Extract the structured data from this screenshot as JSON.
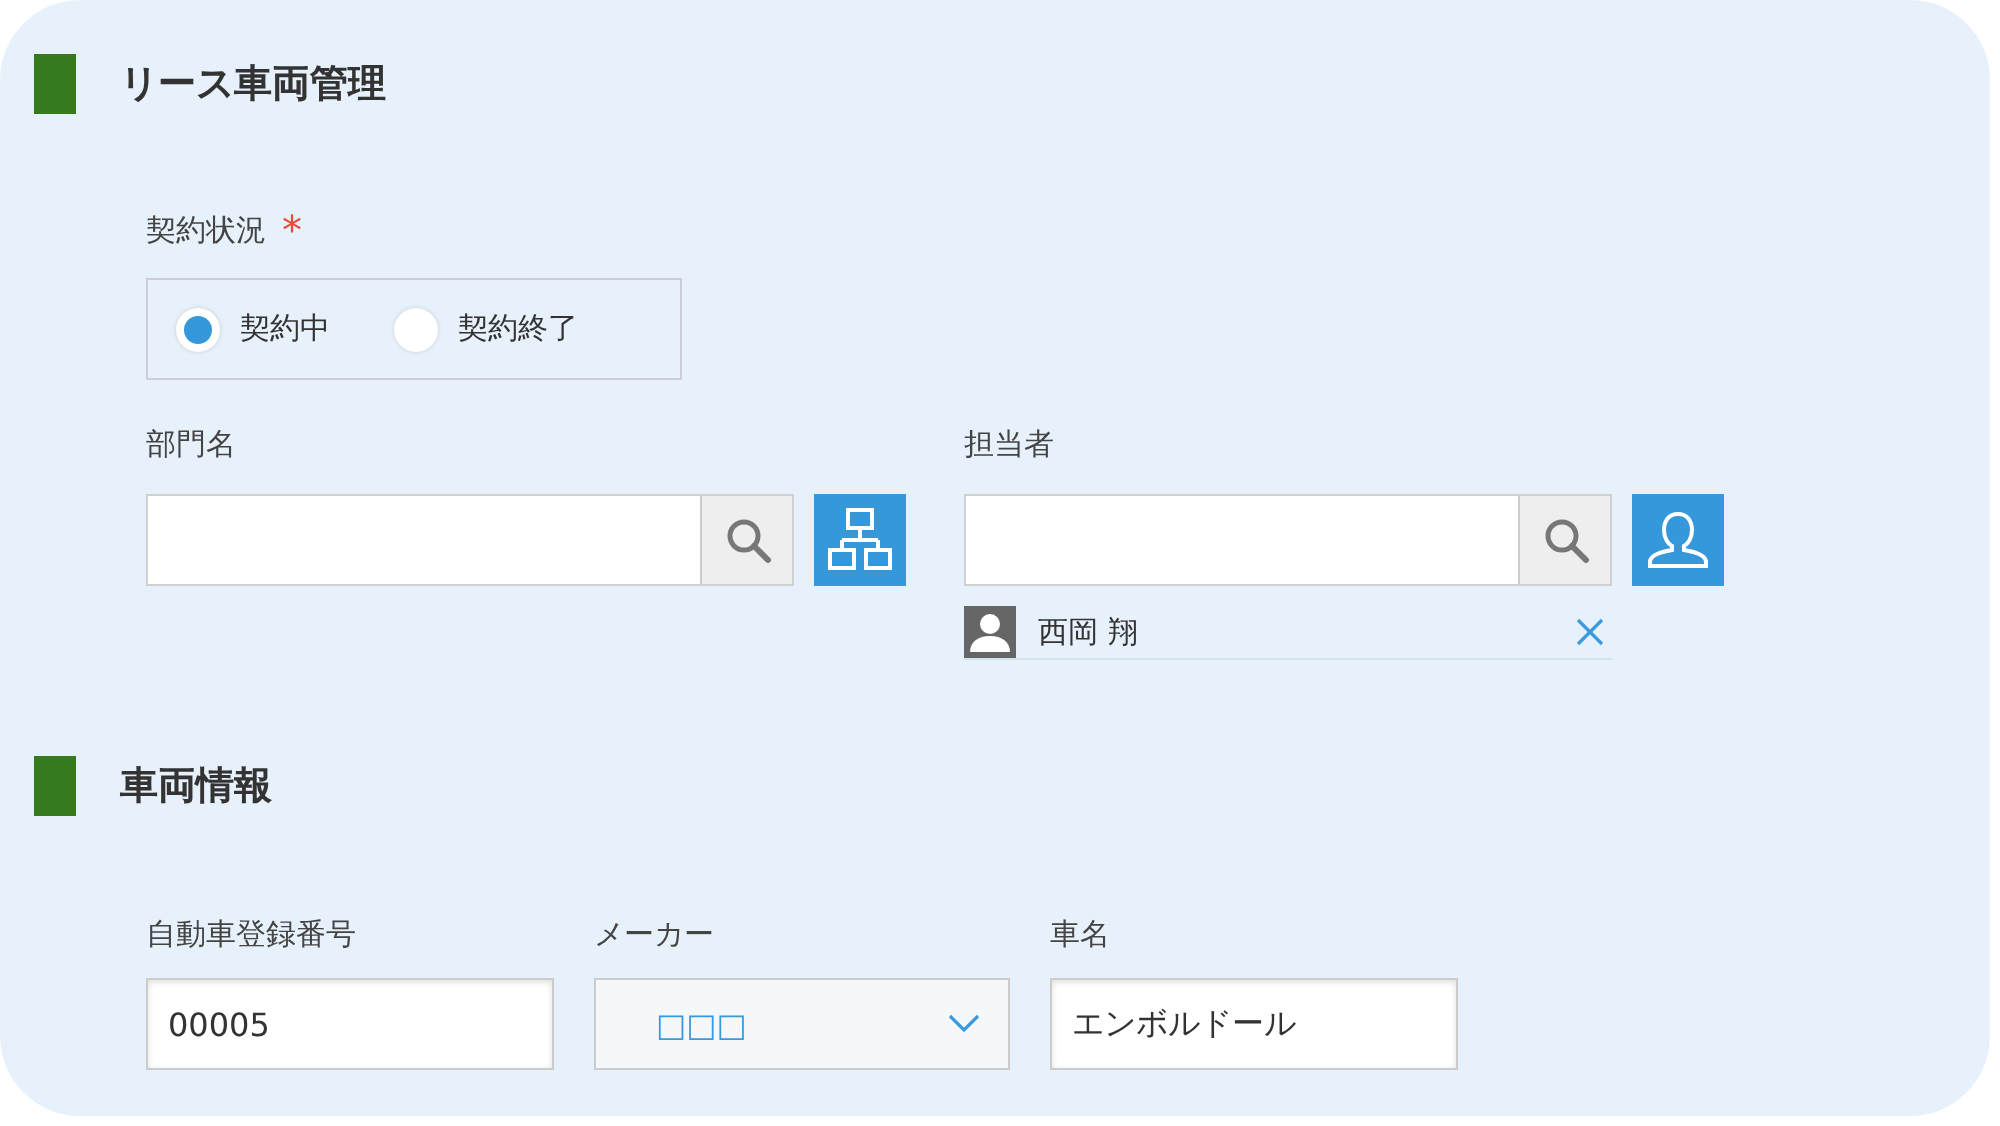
{
  "sections": [
    {
      "title": "リース車両管理"
    },
    {
      "title": "車両情報"
    }
  ],
  "contract_status": {
    "label": "契約状況",
    "required_mark": "*",
    "options": [
      {
        "label": "契約中",
        "selected": true
      },
      {
        "label": "契約終了",
        "selected": false
      }
    ]
  },
  "department": {
    "label": "部門名"
  },
  "assignee": {
    "label": "担当者",
    "users": [
      {
        "name": "西岡 翔"
      }
    ]
  },
  "vehicle_fields": [
    {
      "kind": "text",
      "label": "自動車登録番号",
      "value": "00005"
    },
    {
      "kind": "dropdown",
      "label": "メーカー",
      "value": "□□□"
    },
    {
      "kind": "text",
      "label": "車名",
      "value": "エンボルドール"
    }
  ]
}
